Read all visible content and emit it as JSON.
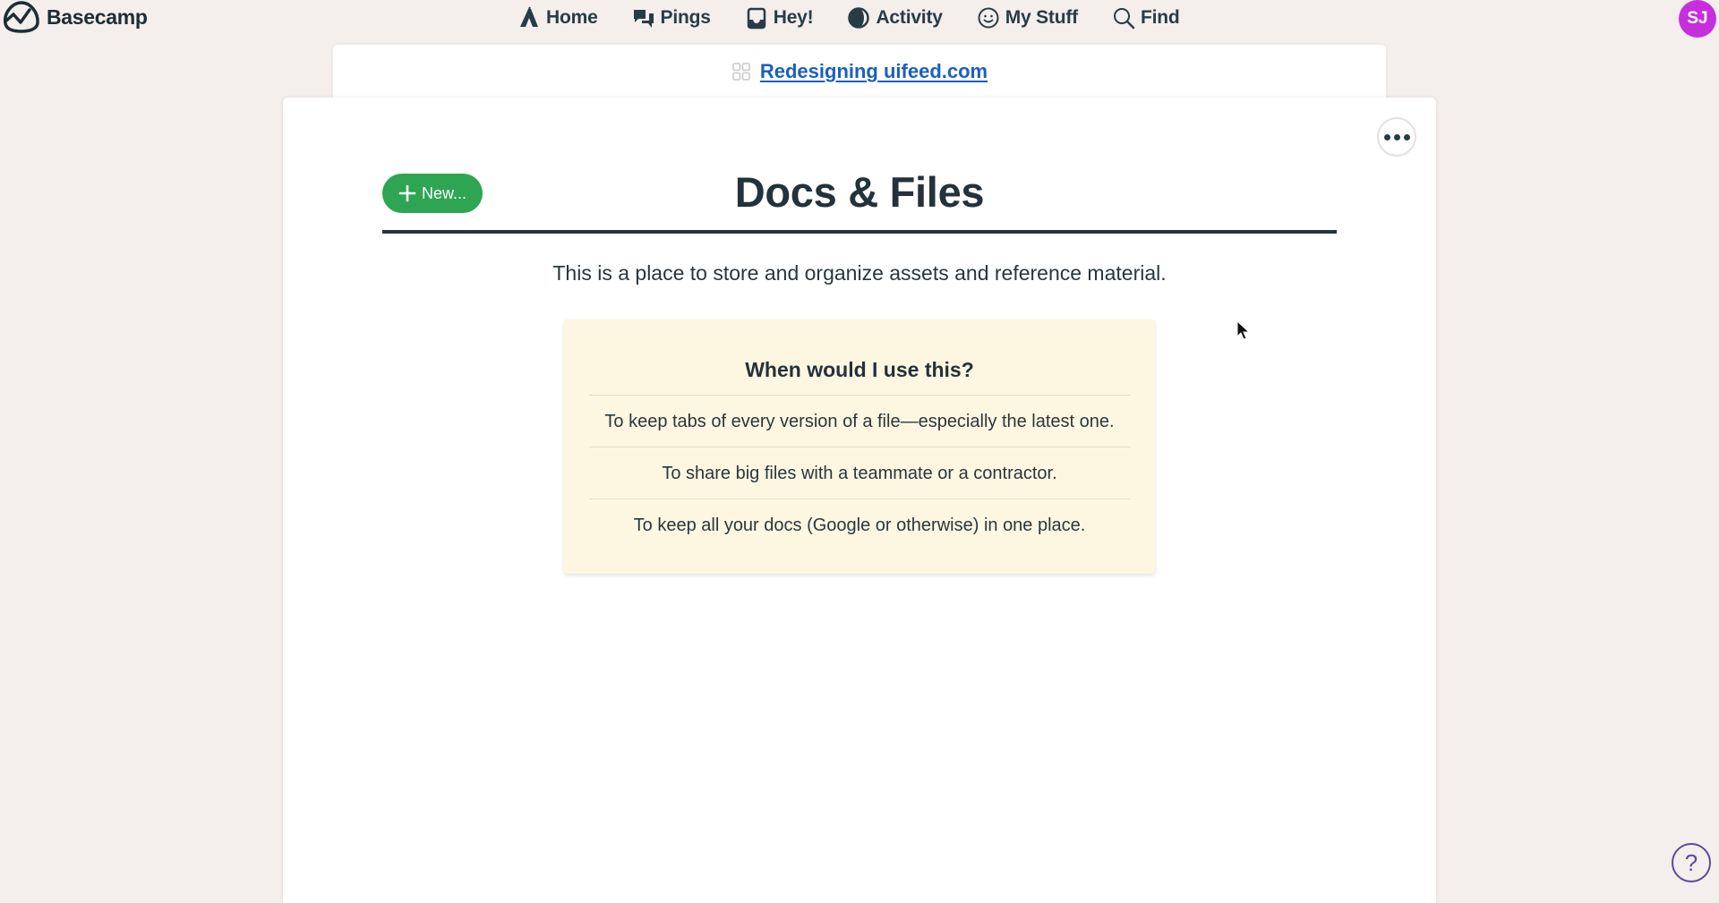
{
  "app": {
    "name": "Basecamp",
    "logo_icon": "basecamp-logo-icon"
  },
  "nav": {
    "items": [
      {
        "label": "Home",
        "icon": "home-tent-icon"
      },
      {
        "label": "Pings",
        "icon": "chat-bubbles-icon"
      },
      {
        "label": "Hey!",
        "icon": "inbox-tray-icon"
      },
      {
        "label": "Activity",
        "icon": "half-moon-icon"
      },
      {
        "label": "My Stuff",
        "icon": "smiley-face-icon"
      },
      {
        "label": "Find",
        "icon": "search-icon"
      }
    ]
  },
  "user": {
    "initials": "SJ",
    "avatar_color": "#c62fdc"
  },
  "project": {
    "name": "Redesigning uifeed.com",
    "icon": "project-grid-icon"
  },
  "page": {
    "title": "Docs & Files",
    "new_button_label": "New...",
    "description": "This is a place to store and organize assets and reference material.",
    "more_options_icon": "ellipsis-icon"
  },
  "help_card": {
    "heading": "When would I use this?",
    "items": [
      "To keep tabs of every version of a file—especially the latest one.",
      "To share big files with a teammate or a contractor.",
      "To keep all your docs (Google or otherwise) in one place."
    ]
  },
  "help_button": {
    "symbol": "?"
  },
  "colors": {
    "background": "#f4eeec",
    "accent_green": "#2da553",
    "link_blue": "#1b5fbf",
    "help_card_bg": "#fdf7e1",
    "help_fab": "#5b4a9c"
  }
}
